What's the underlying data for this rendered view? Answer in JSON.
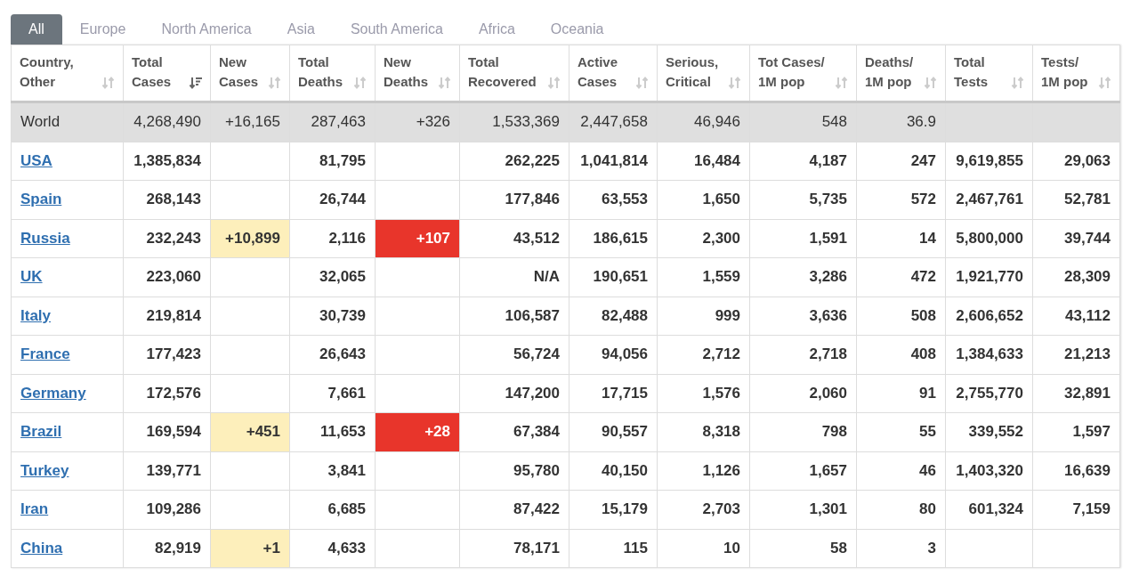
{
  "tabs": [
    {
      "label": "All",
      "selected": true
    },
    {
      "label": "Europe",
      "selected": false
    },
    {
      "label": "North America",
      "selected": false
    },
    {
      "label": "Asia",
      "selected": false
    },
    {
      "label": "South America",
      "selected": false
    },
    {
      "label": "Africa",
      "selected": false
    },
    {
      "label": "Oceania",
      "selected": false
    }
  ],
  "table": {
    "columns": [
      {
        "label": [
          "Country,",
          "Other"
        ],
        "sorted": false
      },
      {
        "label": [
          "Total",
          "Cases"
        ],
        "sorted": true
      },
      {
        "label": [
          "New",
          "Cases"
        ],
        "sorted": false
      },
      {
        "label": [
          "Total",
          "Deaths"
        ],
        "sorted": false
      },
      {
        "label": [
          "New",
          "Deaths"
        ],
        "sorted": false
      },
      {
        "label": [
          "Total",
          "Recovered"
        ],
        "sorted": false
      },
      {
        "label": [
          "Active",
          "Cases"
        ],
        "sorted": false
      },
      {
        "label": [
          "Serious,",
          "Critical"
        ],
        "sorted": false
      },
      {
        "label": [
          "Tot Cases/",
          "1M pop"
        ],
        "sorted": false
      },
      {
        "label": [
          "Deaths/",
          "1M pop"
        ],
        "sorted": false
      },
      {
        "label": [
          "Total",
          "Tests"
        ],
        "sorted": false
      },
      {
        "label": [
          "Tests/",
          "1M pop"
        ],
        "sorted": false
      }
    ],
    "rows": [
      {
        "kind": "total",
        "cells": [
          "World",
          "4,268,490",
          "+16,165",
          "287,463",
          "+326",
          "1,533,369",
          "2,447,658",
          "46,946",
          "548",
          "36.9",
          "",
          ""
        ],
        "new_cases_highlighted": false,
        "new_deaths_highlighted": false
      },
      {
        "kind": "country",
        "cells": [
          "USA",
          "1,385,834",
          "",
          "81,795",
          "",
          "262,225",
          "1,041,814",
          "16,484",
          "4,187",
          "247",
          "9,619,855",
          "29,063"
        ],
        "new_cases_highlighted": false,
        "new_deaths_highlighted": false
      },
      {
        "kind": "country",
        "cells": [
          "Spain",
          "268,143",
          "",
          "26,744",
          "",
          "177,846",
          "63,553",
          "1,650",
          "5,735",
          "572",
          "2,467,761",
          "52,781"
        ],
        "new_cases_highlighted": false,
        "new_deaths_highlighted": false
      },
      {
        "kind": "country",
        "cells": [
          "Russia",
          "232,243",
          "+10,899",
          "2,116",
          "+107",
          "43,512",
          "186,615",
          "2,300",
          "1,591",
          "14",
          "5,800,000",
          "39,744"
        ],
        "new_cases_highlighted": true,
        "new_deaths_highlighted": true
      },
      {
        "kind": "country",
        "cells": [
          "UK",
          "223,060",
          "",
          "32,065",
          "",
          "N/A",
          "190,651",
          "1,559",
          "3,286",
          "472",
          "1,921,770",
          "28,309"
        ],
        "new_cases_highlighted": false,
        "new_deaths_highlighted": false
      },
      {
        "kind": "country",
        "cells": [
          "Italy",
          "219,814",
          "",
          "30,739",
          "",
          "106,587",
          "82,488",
          "999",
          "3,636",
          "508",
          "2,606,652",
          "43,112"
        ],
        "new_cases_highlighted": false,
        "new_deaths_highlighted": false
      },
      {
        "kind": "country",
        "cells": [
          "France",
          "177,423",
          "",
          "26,643",
          "",
          "56,724",
          "94,056",
          "2,712",
          "2,718",
          "408",
          "1,384,633",
          "21,213"
        ],
        "new_cases_highlighted": false,
        "new_deaths_highlighted": false
      },
      {
        "kind": "country",
        "cells": [
          "Germany",
          "172,576",
          "",
          "7,661",
          "",
          "147,200",
          "17,715",
          "1,576",
          "2,060",
          "91",
          "2,755,770",
          "32,891"
        ],
        "new_cases_highlighted": false,
        "new_deaths_highlighted": false
      },
      {
        "kind": "country",
        "cells": [
          "Brazil",
          "169,594",
          "+451",
          "11,653",
          "+28",
          "67,384",
          "90,557",
          "8,318",
          "798",
          "55",
          "339,552",
          "1,597"
        ],
        "new_cases_highlighted": true,
        "new_deaths_highlighted": true
      },
      {
        "kind": "country",
        "cells": [
          "Turkey",
          "139,771",
          "",
          "3,841",
          "",
          "95,780",
          "40,150",
          "1,126",
          "1,657",
          "46",
          "1,403,320",
          "16,639"
        ],
        "new_cases_highlighted": false,
        "new_deaths_highlighted": false
      },
      {
        "kind": "country",
        "cells": [
          "Iran",
          "109,286",
          "",
          "6,685",
          "",
          "87,422",
          "15,179",
          "2,703",
          "1,301",
          "80",
          "601,324",
          "7,159"
        ],
        "new_cases_highlighted": false,
        "new_deaths_highlighted": false
      },
      {
        "kind": "country",
        "cells": [
          "China",
          "82,919",
          "+1",
          "4,633",
          "",
          "78,171",
          "115",
          "10",
          "58",
          "3",
          "",
          ""
        ],
        "new_cases_highlighted": true,
        "new_deaths_highlighted": false
      }
    ]
  }
}
